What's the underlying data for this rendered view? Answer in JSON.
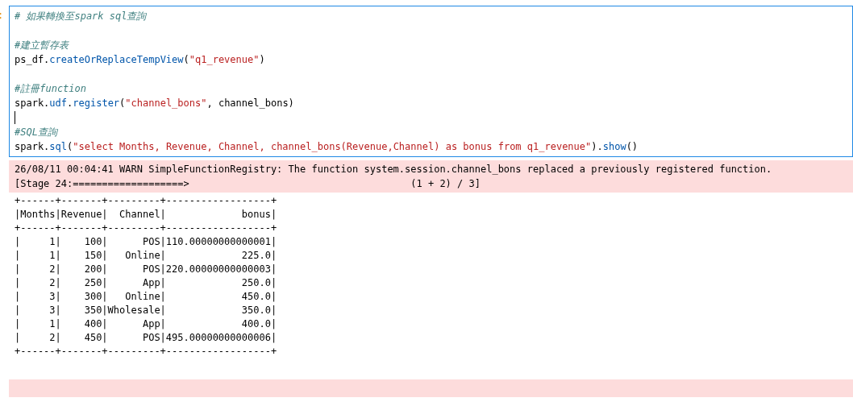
{
  "prompt": ":",
  "code_lines": [
    {
      "tokens": [
        {
          "kind": "comment",
          "text": "# 如果轉換至spark sql查詢"
        }
      ]
    },
    {
      "blank_line_before": true,
      "tokens": [
        {
          "kind": "comment",
          "text": "#建立暫存表"
        }
      ]
    },
    {
      "tokens": [
        {
          "kind": "plain",
          "text": "ps_df."
        },
        {
          "kind": "method",
          "text": "createOrReplaceTempView"
        },
        {
          "kind": "plain",
          "text": "("
        },
        {
          "kind": "string",
          "text": "\"q1_revenue\""
        },
        {
          "kind": "plain",
          "text": ")"
        }
      ]
    },
    {
      "blank_line_before": true,
      "tokens": [
        {
          "kind": "comment",
          "text": "#註冊function"
        }
      ]
    },
    {
      "tokens": [
        {
          "kind": "plain",
          "text": "spark."
        },
        {
          "kind": "method",
          "text": "udf"
        },
        {
          "kind": "plain",
          "text": "."
        },
        {
          "kind": "method",
          "text": "register"
        },
        {
          "kind": "plain",
          "text": "("
        },
        {
          "kind": "string",
          "text": "\"channel_bons\""
        },
        {
          "kind": "plain",
          "text": ", channel_bons)"
        }
      ]
    },
    {
      "cursor": true
    },
    {
      "tokens": [
        {
          "kind": "comment",
          "text": "#SQL查詢"
        }
      ]
    },
    {
      "tokens": [
        {
          "kind": "plain",
          "text": "spark."
        },
        {
          "kind": "method",
          "text": "sql"
        },
        {
          "kind": "plain",
          "text": "("
        },
        {
          "kind": "string",
          "text": "\"select Months, Revenue, Channel, channel_bons(Revenue,Channel) as bonus from q1_revenue\""
        },
        {
          "kind": "plain",
          "text": ")."
        },
        {
          "kind": "method",
          "text": "show"
        },
        {
          "kind": "plain",
          "text": "()"
        }
      ]
    }
  ],
  "stderr_lines": [
    "26/08/11 00:04:41 WARN SimpleFunctionRegistry: The function system.session.channel_bons replaced a previously registered function.",
    "[Stage 24:===================>                                      (1 + 2) / 3]"
  ],
  "stdout_lines": [
    "+------+-------+---------+------------------+",
    "|Months|Revenue|  Channel|             bonus|",
    "+------+-------+---------+------------------+",
    "|     1|    100|      POS|110.00000000000001|",
    "|     1|    150|   Online|             225.0|",
    "|     2|    200|      POS|220.00000000000003|",
    "|     2|    250|      App|             250.0|",
    "|     3|    300|   Online|             450.0|",
    "|     3|    350|Wholesale|             350.0|",
    "|     1|    400|      App|             400.0|",
    "|     2|    450|      POS|495.00000000000006|",
    "+------+-------+---------+------------------+"
  ]
}
